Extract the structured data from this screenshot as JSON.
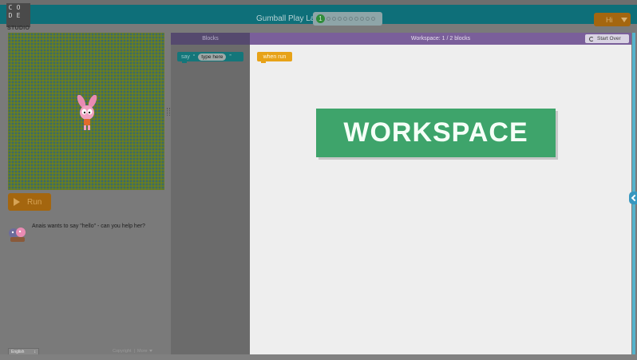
{
  "header": {
    "logo_letters": [
      "C",
      "O",
      "",
      "D",
      "E",
      ""
    ],
    "logo_subtitle": "STUDIO",
    "app_title": "Gumball Play Lab",
    "progress": {
      "current_level": "1",
      "total_levels": 10
    },
    "user_menu_label": "Hi"
  },
  "game": {
    "run_label": "Run",
    "instructions": "Anais wants to say \"hello\" - can you help her?"
  },
  "footer": {
    "language": "English",
    "copyright": "Copyright",
    "more": "More"
  },
  "toolbox": {
    "header": "Blocks",
    "say_block": {
      "label": "say",
      "open_quote": "“",
      "field": "type here",
      "close_quote": "”"
    }
  },
  "workspace": {
    "header": "Workspace: 1 / 2 blocks",
    "start_over_label": "Start Over",
    "when_run_label": "when run",
    "banner": "WORKSPACE"
  },
  "colors": {
    "header_teal": "#0e6f79",
    "workspace_purple": "#7a5f9a",
    "toolbox_purple": "#55496e",
    "run_orange": "#a4660f",
    "event_block": "#e7a218",
    "say_block": "#14767a",
    "banner_green": "#3ea46b"
  }
}
